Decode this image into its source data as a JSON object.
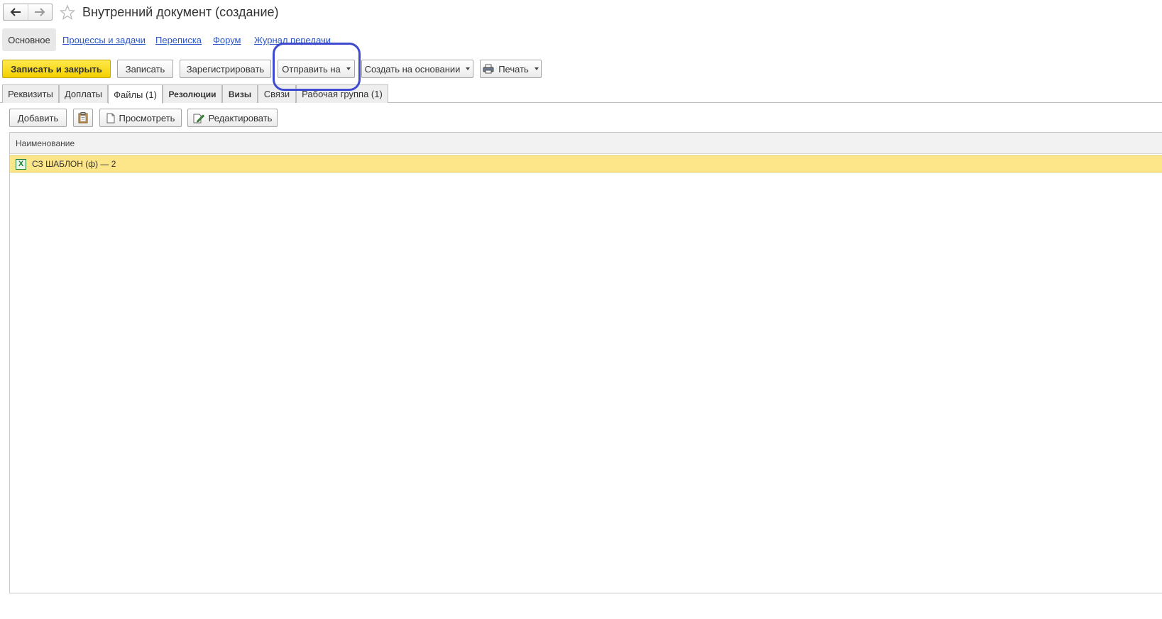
{
  "window": {
    "title": "Внутренний документ (создание)",
    "back_icon": "arrow-left-icon",
    "forward_icon": "arrow-right-icon",
    "favorite_icon": "star-icon"
  },
  "sections": {
    "active": "Основное",
    "links": [
      "Процессы и задачи",
      "Переписка",
      "Форум",
      "Журнал передачи"
    ]
  },
  "toolbar": {
    "save_close": "Записать и закрыть",
    "save": "Записать",
    "register": "Зарегистрировать",
    "send_to": "Отправить на",
    "create_based": "Создать на основании",
    "print": "Печать"
  },
  "tabs": [
    {
      "label": "Реквизиты"
    },
    {
      "label": "Доплаты"
    },
    {
      "label": "Файлы (1)"
    },
    {
      "label": "Резолюции"
    },
    {
      "label": "Визы"
    },
    {
      "label": "Связи"
    },
    {
      "label": "Рабочая группа (1)"
    }
  ],
  "files_toolbar": {
    "add": "Добавить",
    "view": "Просмотреть",
    "edit": "Редактировать"
  },
  "table": {
    "header": "Наименование",
    "rows": [
      {
        "name": "СЗ ШАБЛОН (ф) — 2",
        "icon": "excel-file-icon"
      }
    ]
  },
  "colors": {
    "primary_button": "#f3d000",
    "selected_row": "#fde58a",
    "link": "#2a56c6",
    "annotation": "#3e4bd0"
  }
}
